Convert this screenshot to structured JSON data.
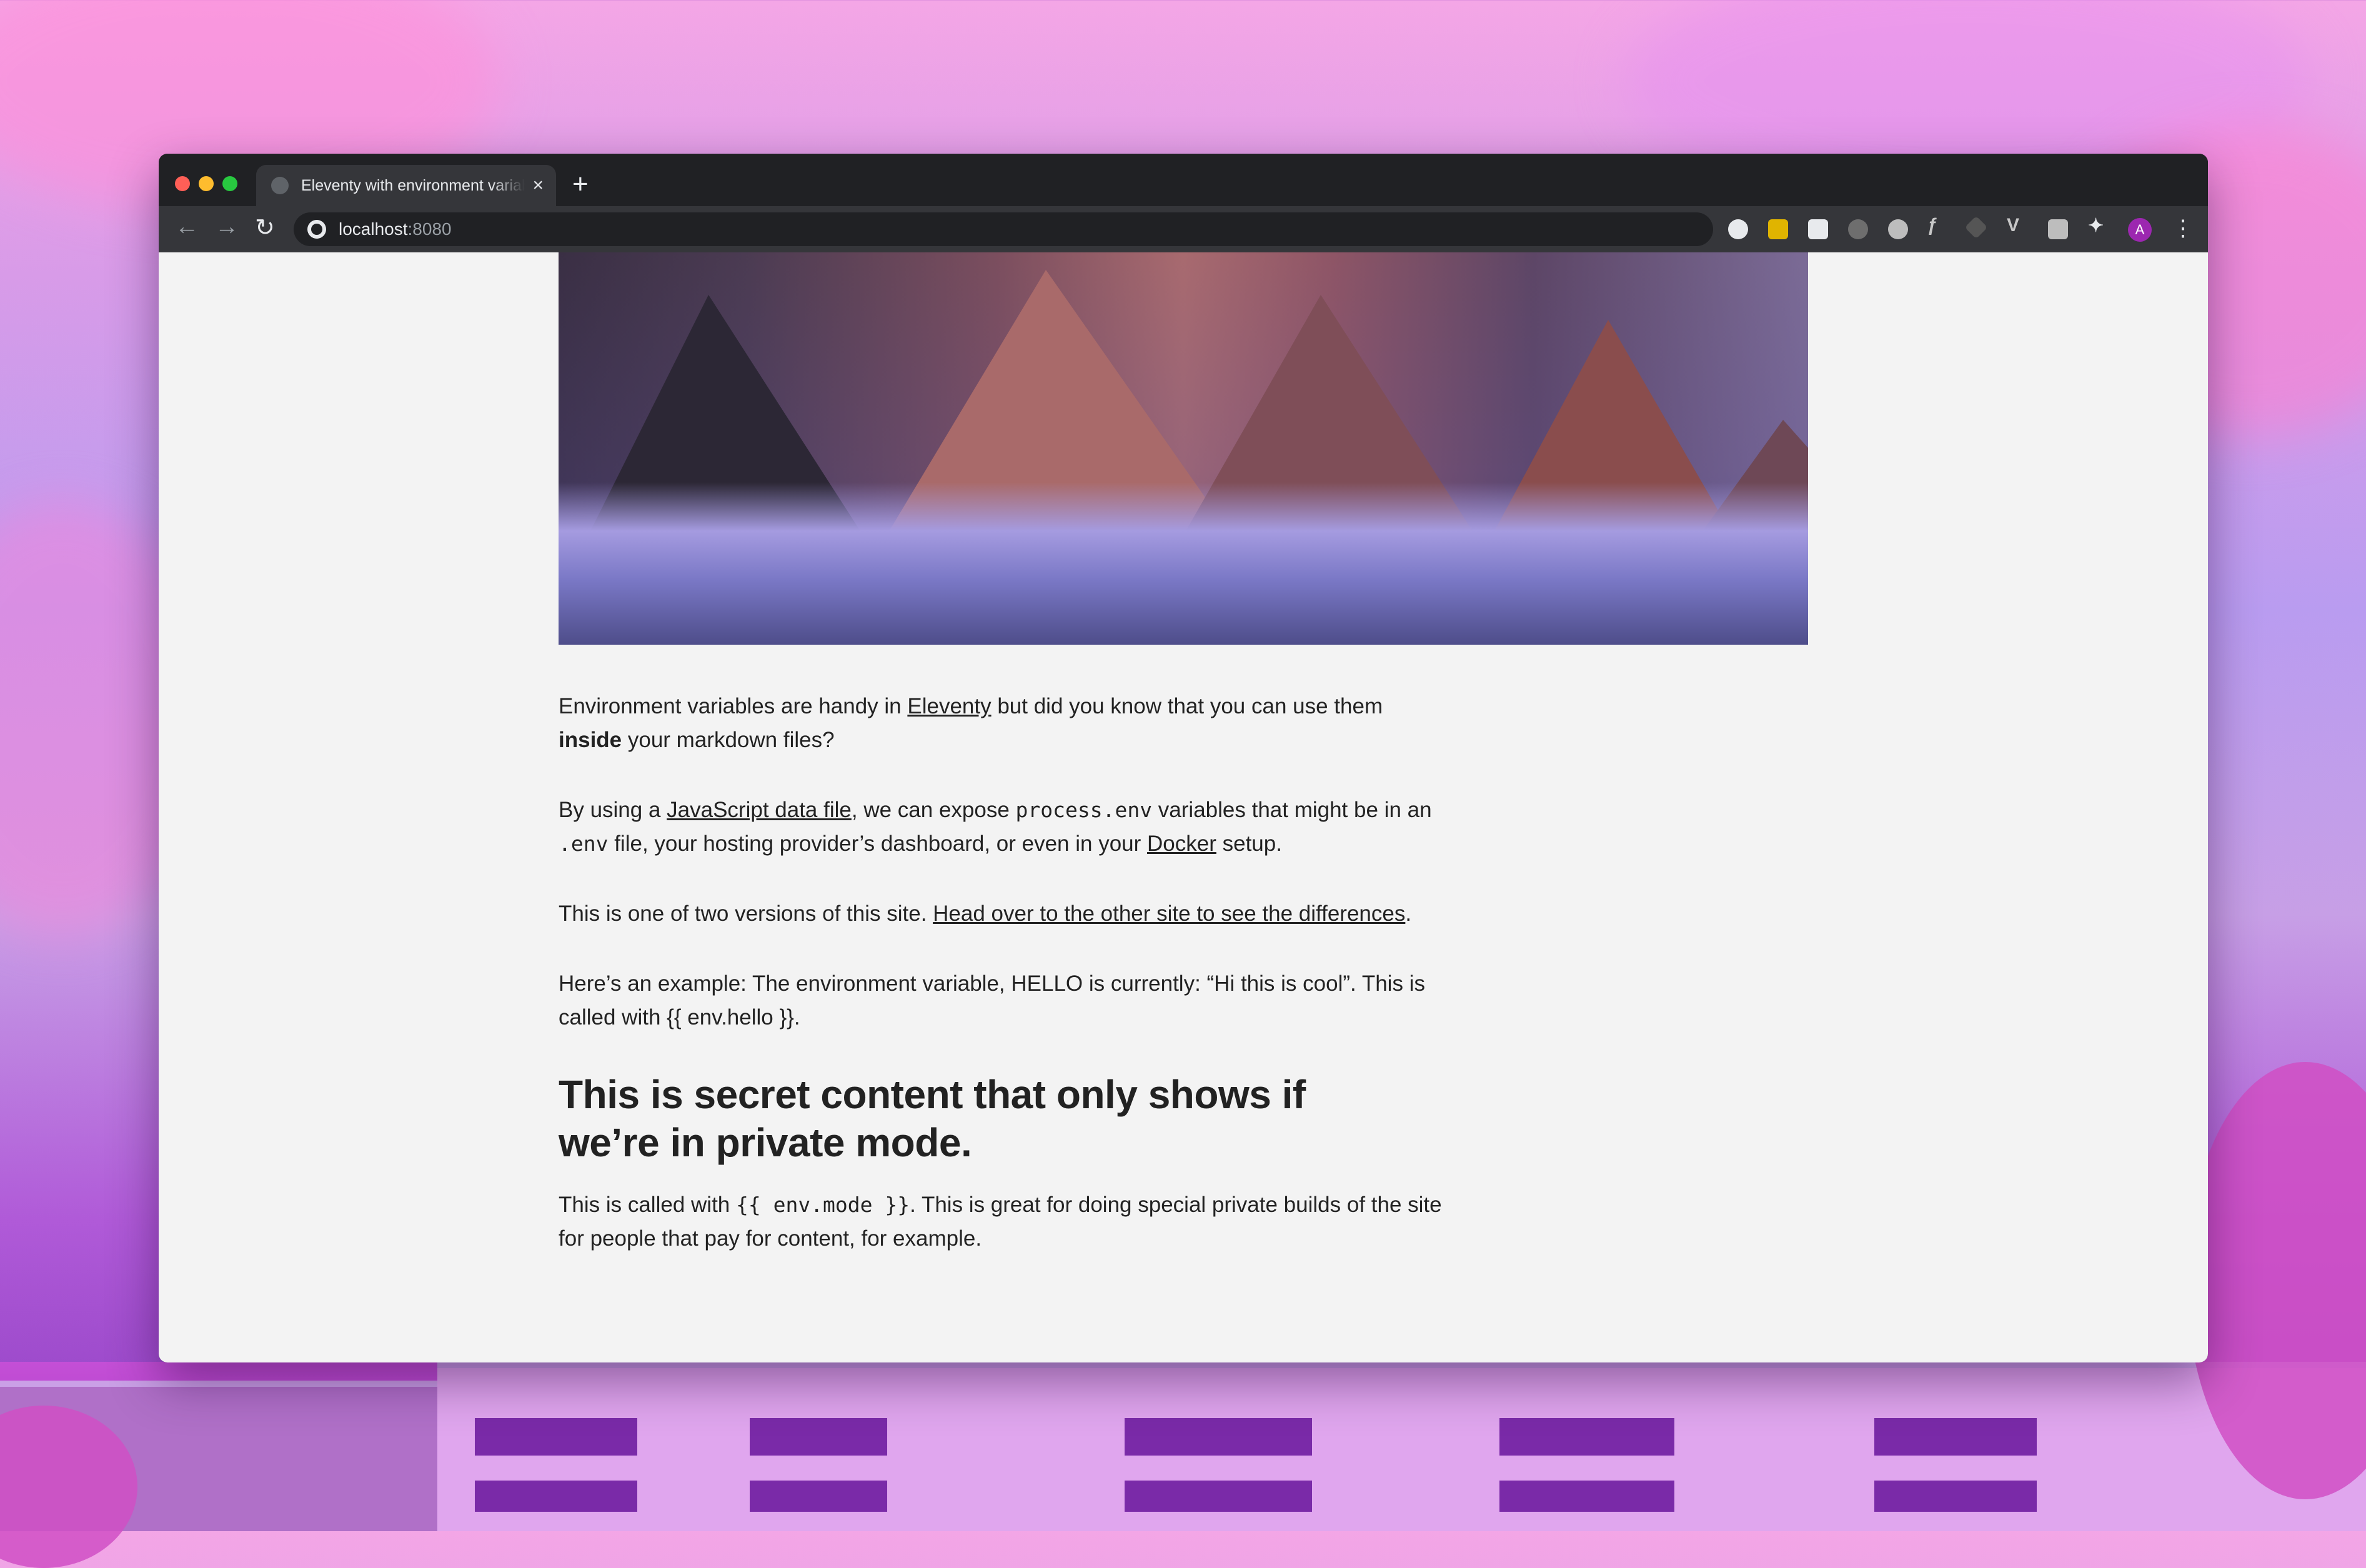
{
  "browser": {
    "tab_title": "Eleventy with environment variables",
    "new_tab_symbol": "+",
    "close_symbol": "×",
    "url_host": "localhost",
    "url_port": ":8080",
    "profile_initial": "A"
  },
  "article": {
    "p1": {
      "before": "Environment variables are handy in ",
      "link": "Eleventy",
      "middle": " but did you know that you can use them ",
      "bold": "inside",
      "after": " your markdown files?"
    },
    "p2": {
      "before": "By using a ",
      "link1": "JavaScript data file",
      "t1": ", we can expose ",
      "code1": "process.env",
      "t2": " variables that might be in an ",
      "code2": ".env",
      "t3": " file, your hosting provider’s dashboard, or even in your ",
      "link2": "Docker",
      "after": " setup."
    },
    "p3": {
      "before": "This is one of two versions of this site. ",
      "link": "Head over to the other site to see the differences",
      "after": "."
    },
    "p4": "Here’s an example: The environment variable, HELLO is currently: “Hi this is cool”. This is called with {{ env.hello }}.",
    "heading": "This is secret content that only shows if we’re in private mode.",
    "p5": {
      "before": "This is called with ",
      "code": "{{ env.mode }}",
      "after": ". This is great for doing special private builds of the site for people that pay for content, for example."
    }
  },
  "colors": {
    "window_frame": "#202124",
    "toolbar": "#35363a",
    "page_background": "#f3f3f3",
    "text": "#222222"
  },
  "icons": [
    "back-arrow-icon",
    "forward-arrow-icon",
    "reload-icon",
    "site-info-icon",
    "close-icon",
    "plus-icon",
    "extension-icons",
    "puzzle-icon",
    "kebab-menu-icon"
  ]
}
